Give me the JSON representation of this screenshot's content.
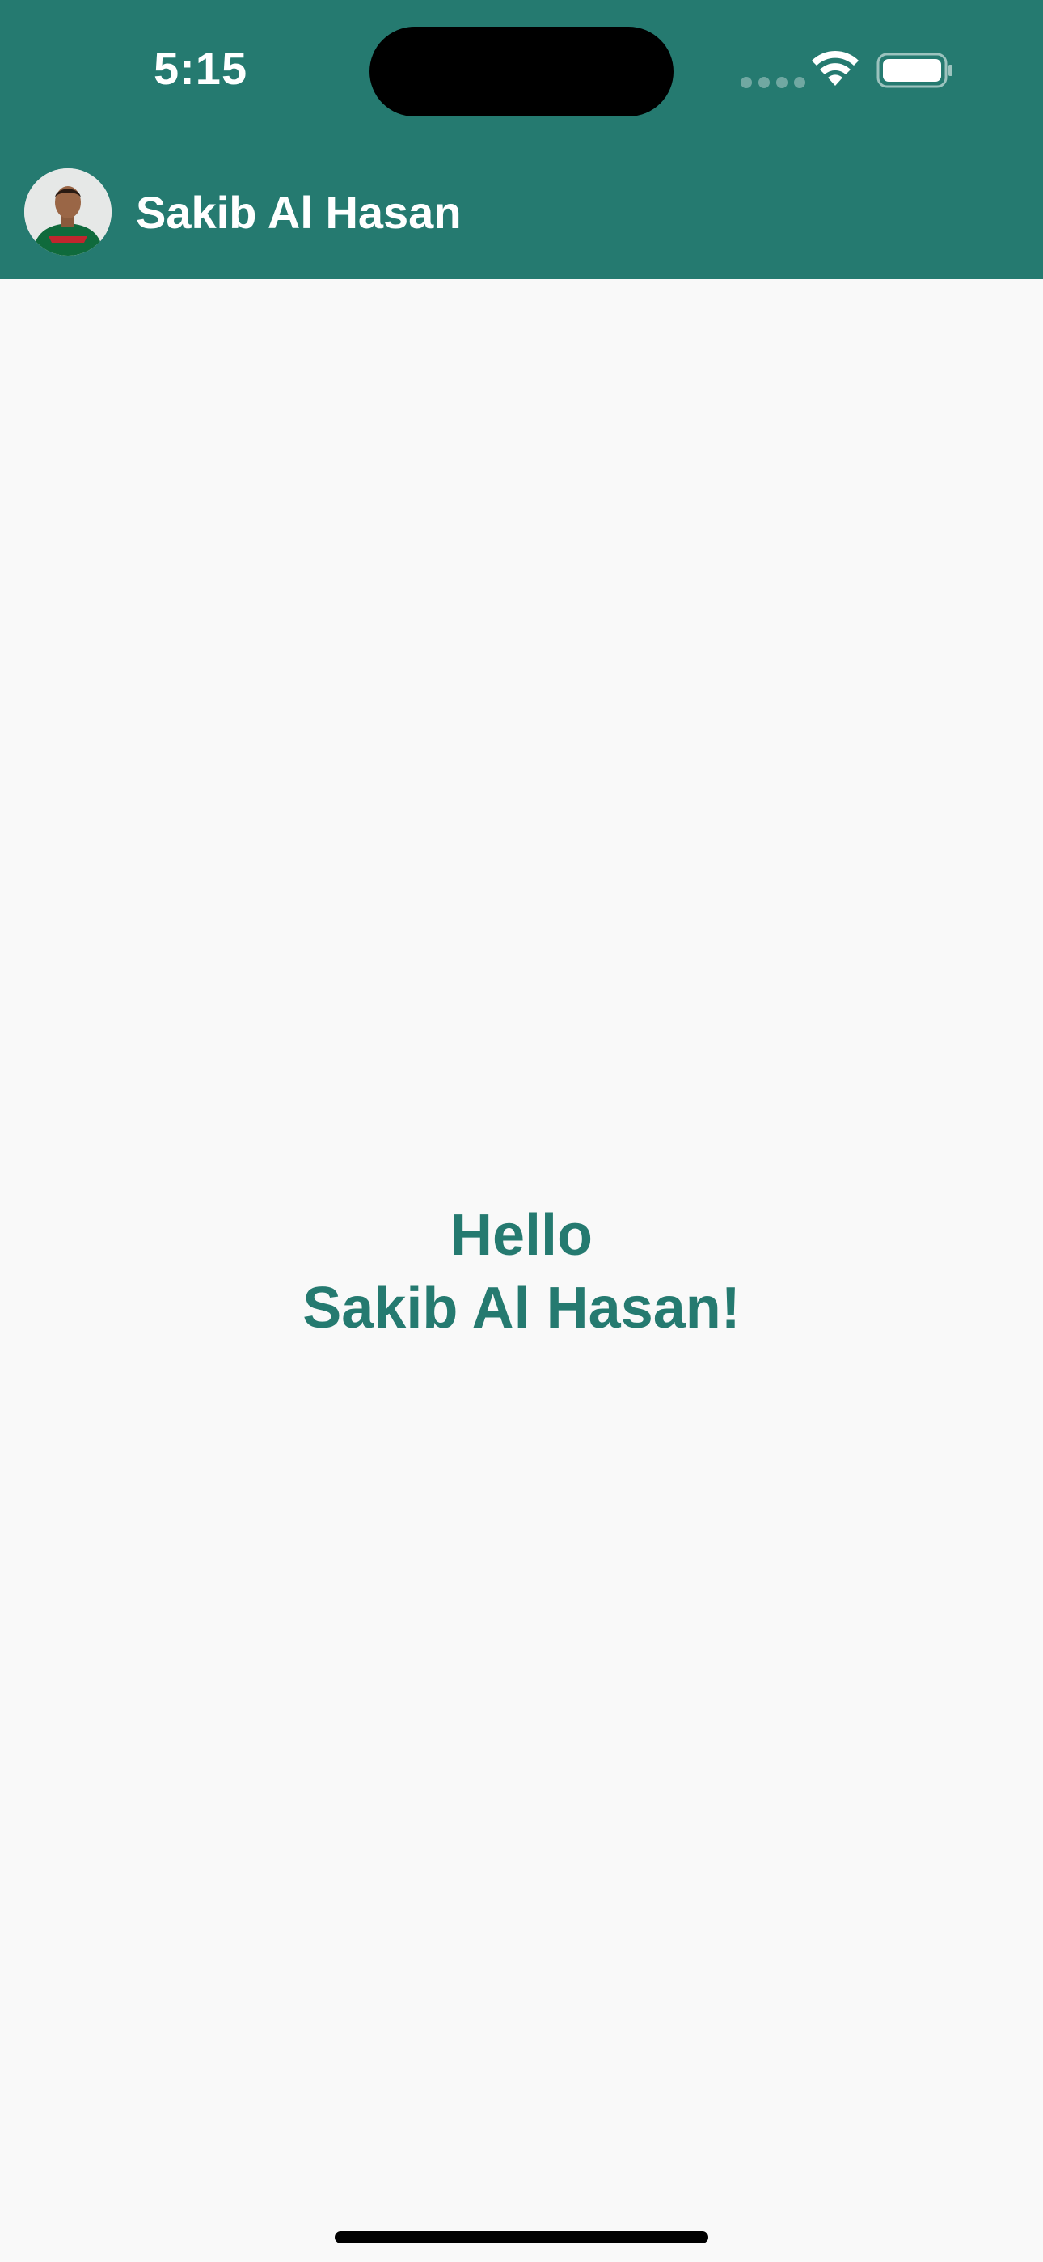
{
  "status_bar": {
    "time": "5:15"
  },
  "header": {
    "user_name": "Sakib Al Hasan",
    "avatar_icon": "user-photo-icon",
    "background_color": "#257a70"
  },
  "greeting": {
    "line1": "Hello",
    "line2": "Sakib Al Hasan!",
    "color": "#257a70"
  },
  "page": {
    "background_color": "#f9f9f9"
  }
}
